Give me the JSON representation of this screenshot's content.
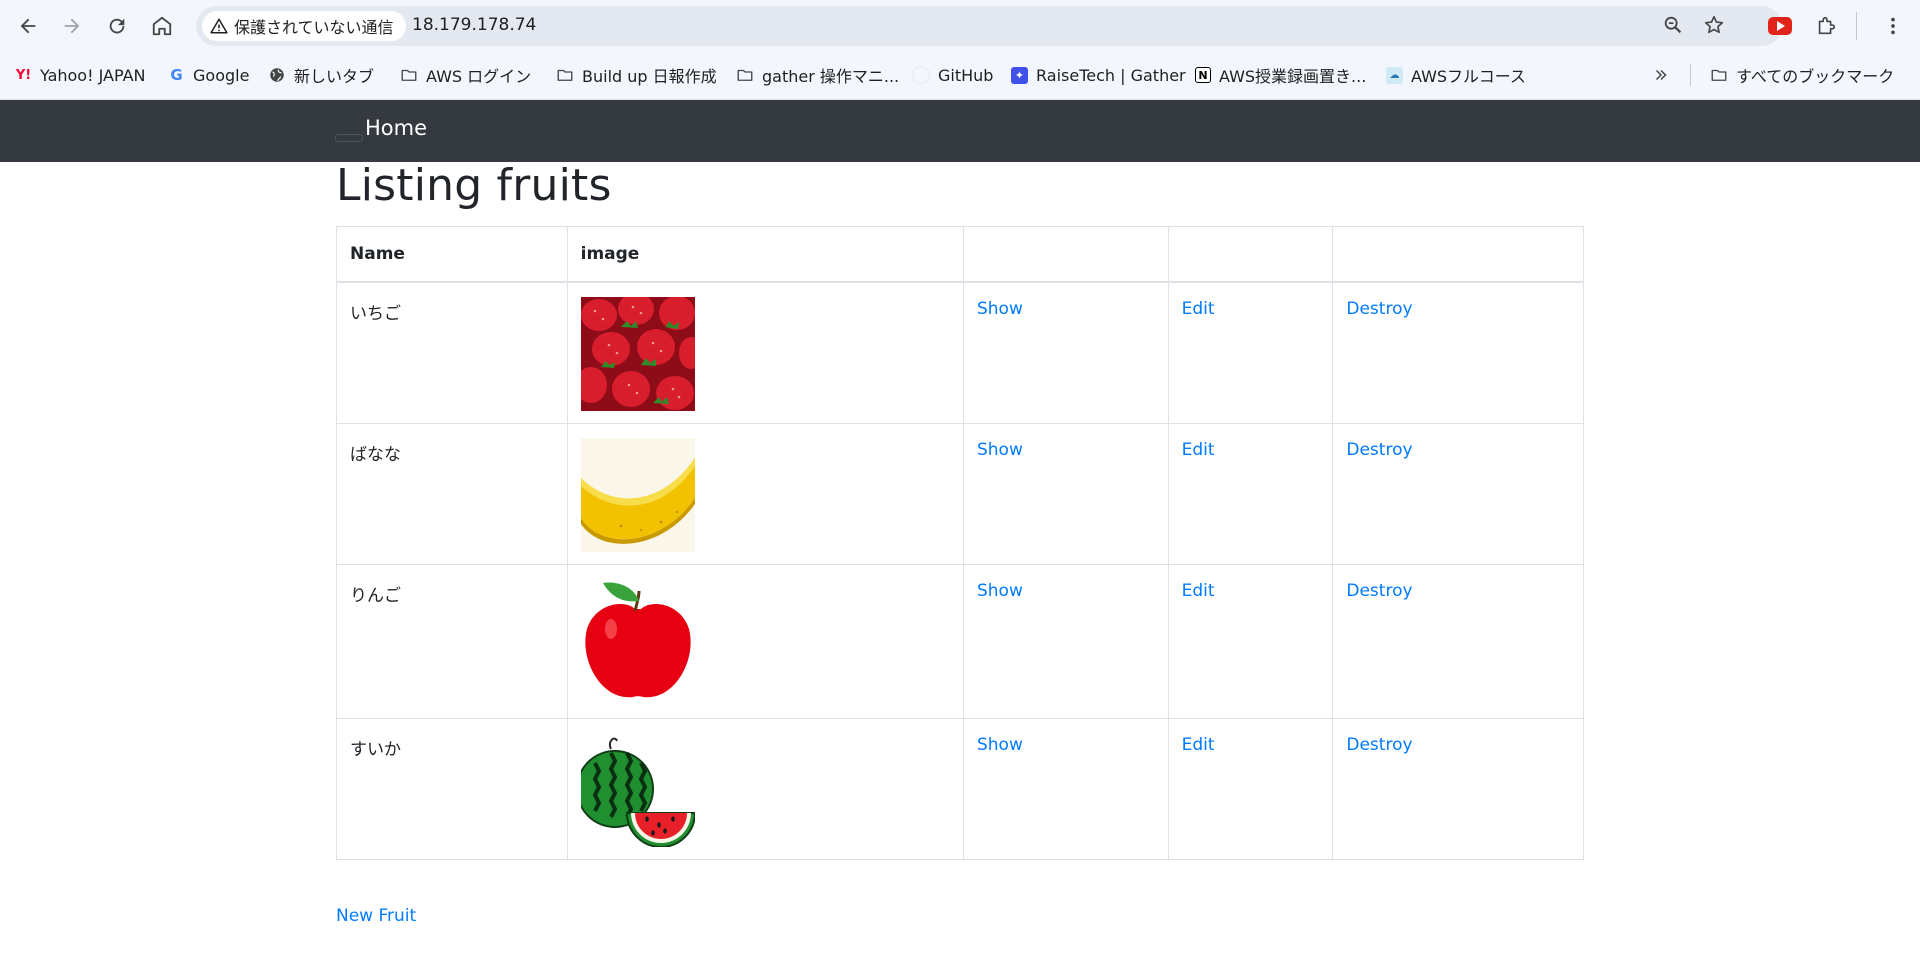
{
  "browser": {
    "security_label": "保護されていない通信",
    "url": "18.179.178.74",
    "bookmarks": [
      {
        "label": "Yahoo! JAPAN",
        "icon": "yahoo-icon"
      },
      {
        "label": "Google",
        "icon": "google-icon"
      },
      {
        "label": "新しいタブ",
        "icon": "globe-icon"
      },
      {
        "label": "AWS ログイン",
        "icon": "folder-icon"
      },
      {
        "label": "Build up 日報作成",
        "icon": "folder-icon"
      },
      {
        "label": "gather 操作マニ...",
        "icon": "folder-icon"
      },
      {
        "label": "GitHub",
        "icon": "github-icon"
      },
      {
        "label": "RaiseTech | Gather",
        "icon": "gather-icon"
      },
      {
        "label": "AWS授業録画置き...",
        "icon": "notion-icon"
      },
      {
        "label": "AWSフルコース",
        "icon": "aws-course-icon"
      }
    ],
    "all_bookmarks_label": "すべてのブックマーク"
  },
  "navbar": {
    "home_label": "Home"
  },
  "page": {
    "title": "Listing fruits",
    "columns": [
      "Name",
      "image",
      "",
      "",
      ""
    ],
    "rows": [
      {
        "name": "いちご",
        "image": "strawberry-image",
        "show": "Show",
        "edit": "Edit",
        "destroy": "Destroy"
      },
      {
        "name": "ばなな",
        "image": "banana-image",
        "show": "Show",
        "edit": "Edit",
        "destroy": "Destroy"
      },
      {
        "name": "りんご",
        "image": "apple-image",
        "show": "Show",
        "edit": "Edit",
        "destroy": "Destroy"
      },
      {
        "name": "すいか",
        "image": "watermelon-image",
        "show": "Show",
        "edit": "Edit",
        "destroy": "Destroy"
      }
    ],
    "new_link": "New Fruit"
  },
  "colors": {
    "navbar_bg": "#343a40",
    "link": "#007bff",
    "chrome_bg": "#f3f6fc"
  }
}
